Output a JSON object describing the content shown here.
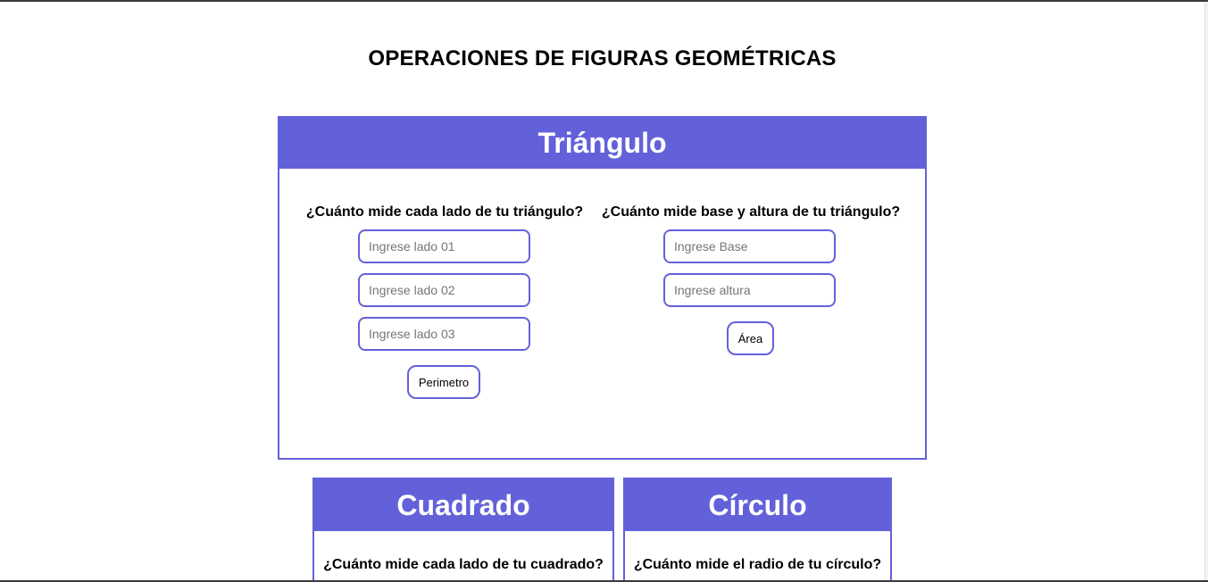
{
  "page": {
    "title": "OPERACIONES DE FIGURAS GEOMÉTRICAS"
  },
  "triangle": {
    "title": "Triángulo",
    "perimeter_question": "¿Cuánto mide cada lado de tu triángulo?",
    "side1_placeholder": "Ingrese lado 01",
    "side2_placeholder": "Ingrese lado 02",
    "side3_placeholder": "Ingrese lado 03",
    "perimeter_button": "Perimetro",
    "area_question": "¿Cuánto mide base y altura de tu triángulo?",
    "base_placeholder": "Ingrese Base",
    "height_placeholder": "Ingrese altura",
    "area_button": "Área"
  },
  "square": {
    "title": "Cuadrado",
    "question": "¿Cuánto mide cada lado de tu cuadrado?"
  },
  "circle": {
    "title": "Círculo",
    "question": "¿Cuánto mide el radio de tu círculo?"
  },
  "colors": {
    "accent": "#6361d9",
    "background": "#ffffff",
    "text": "#000000"
  }
}
